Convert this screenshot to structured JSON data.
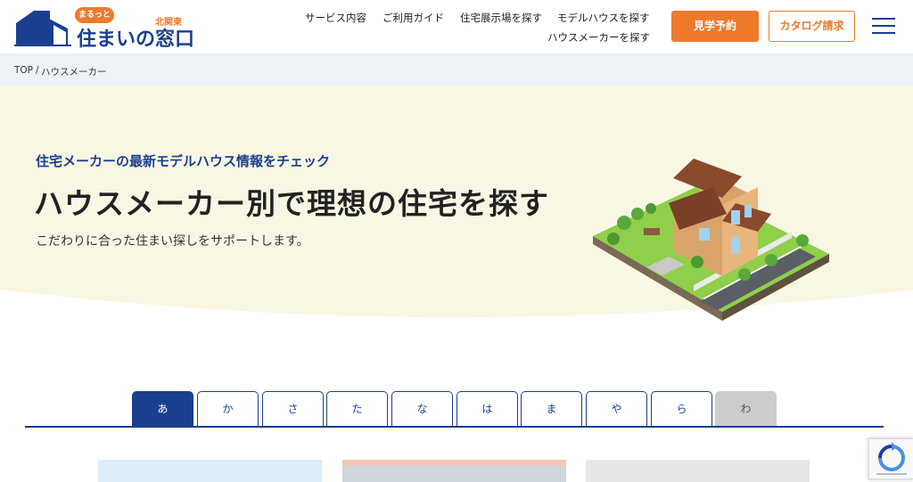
{
  "header": {
    "logo": {
      "badge": "まるっと",
      "region": "北関東",
      "name": "住まいの窓口"
    },
    "nav": {
      "service": "サービス内容",
      "guide": "ご利用ガイド",
      "exhibition": "住宅展示場を探す",
      "model_house": "モデルハウスを探す",
      "house_maker": "ハウスメーカーを探す"
    },
    "visit_button": "見学予約",
    "catalog_button": "カタログ請求"
  },
  "breadcrumb": {
    "home": "TOP",
    "separator": "/",
    "current": "ハウスメーカー"
  },
  "hero": {
    "subtitle": "住宅メーカーの最新モデルハウス情報をチェック",
    "title": "ハウスメーカー別で理想の住宅を探す",
    "description": "こだわりに合った住まい探しをサポートします。"
  },
  "tabs": [
    {
      "label": "あ",
      "state": "active"
    },
    {
      "label": "か",
      "state": "normal"
    },
    {
      "label": "さ",
      "state": "normal"
    },
    {
      "label": "た",
      "state": "normal"
    },
    {
      "label": "な",
      "state": "normal"
    },
    {
      "label": "は",
      "state": "normal"
    },
    {
      "label": "ま",
      "state": "normal"
    },
    {
      "label": "や",
      "state": "normal"
    },
    {
      "label": "ら",
      "state": "normal"
    },
    {
      "label": "わ",
      "state": "disabled"
    }
  ],
  "colors": {
    "brand_blue": "#1b3f8f",
    "accent_orange": "#ef7a2c",
    "hero_cream": "#f9f6e4",
    "breadcrumb_bg": "#edf2f6"
  },
  "icons": {
    "logo": "house-logo-icon",
    "menu": "hamburger-menu-icon",
    "recaptcha": "recaptcha-icon"
  }
}
